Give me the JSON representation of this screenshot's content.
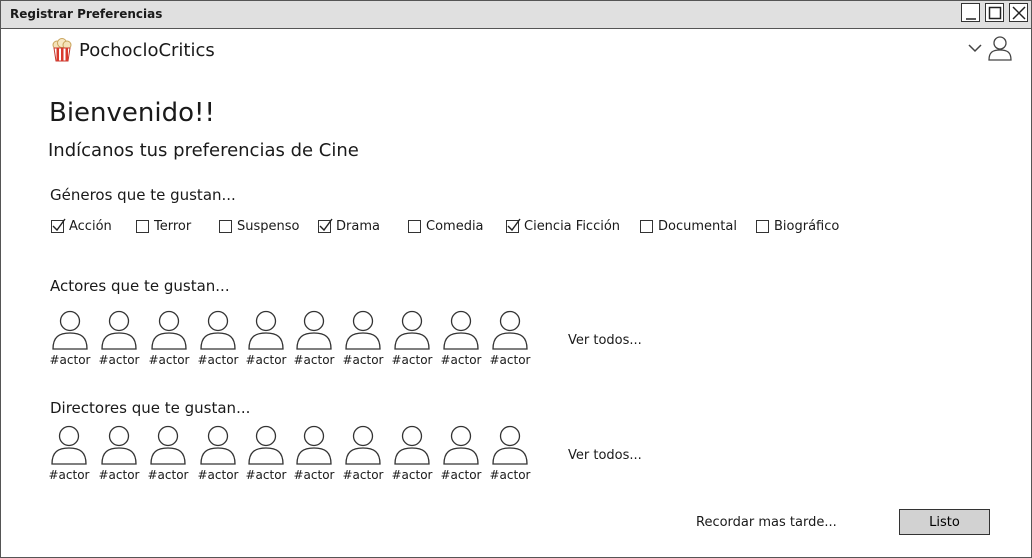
{
  "window": {
    "title": "Registrar Preferencias"
  },
  "brand": {
    "name": "PochocloCritics",
    "logo_icon": "popcorn-icon"
  },
  "header": {
    "user_icon": "user-icon",
    "menu_icon": "chevron-down-icon"
  },
  "welcome": {
    "title": "Bienvenido!!",
    "subtitle": "Indícanos tus preferencias de Cine"
  },
  "genres": {
    "heading": "Géneros que te gustan...",
    "items": [
      {
        "label": "Acción",
        "checked": true
      },
      {
        "label": "Terror",
        "checked": false
      },
      {
        "label": "Suspenso",
        "checked": false
      },
      {
        "label": "Drama",
        "checked": true
      },
      {
        "label": "Comedia",
        "checked": false
      },
      {
        "label": "Ciencia Ficción",
        "checked": true
      },
      {
        "label": "Documental",
        "checked": false
      },
      {
        "label": "Biográfico",
        "checked": false
      }
    ]
  },
  "actors": {
    "heading": "Actores que te gustan...",
    "items": [
      "#actor",
      "#actor",
      "#actor",
      "#actor",
      "#actor",
      "#actor",
      "#actor",
      "#actor",
      "#actor",
      "#actor"
    ],
    "see_all": "Ver todos..."
  },
  "directors": {
    "heading": "Directores que te gustan...",
    "items": [
      "#actor",
      "#actor",
      "#actor",
      "#actor",
      "#actor",
      "#actor",
      "#actor",
      "#actor",
      "#actor",
      "#actor"
    ],
    "see_all": "Ver todos..."
  },
  "footer": {
    "remind_later": "Recordar mas tarde...",
    "done": "Listo"
  }
}
